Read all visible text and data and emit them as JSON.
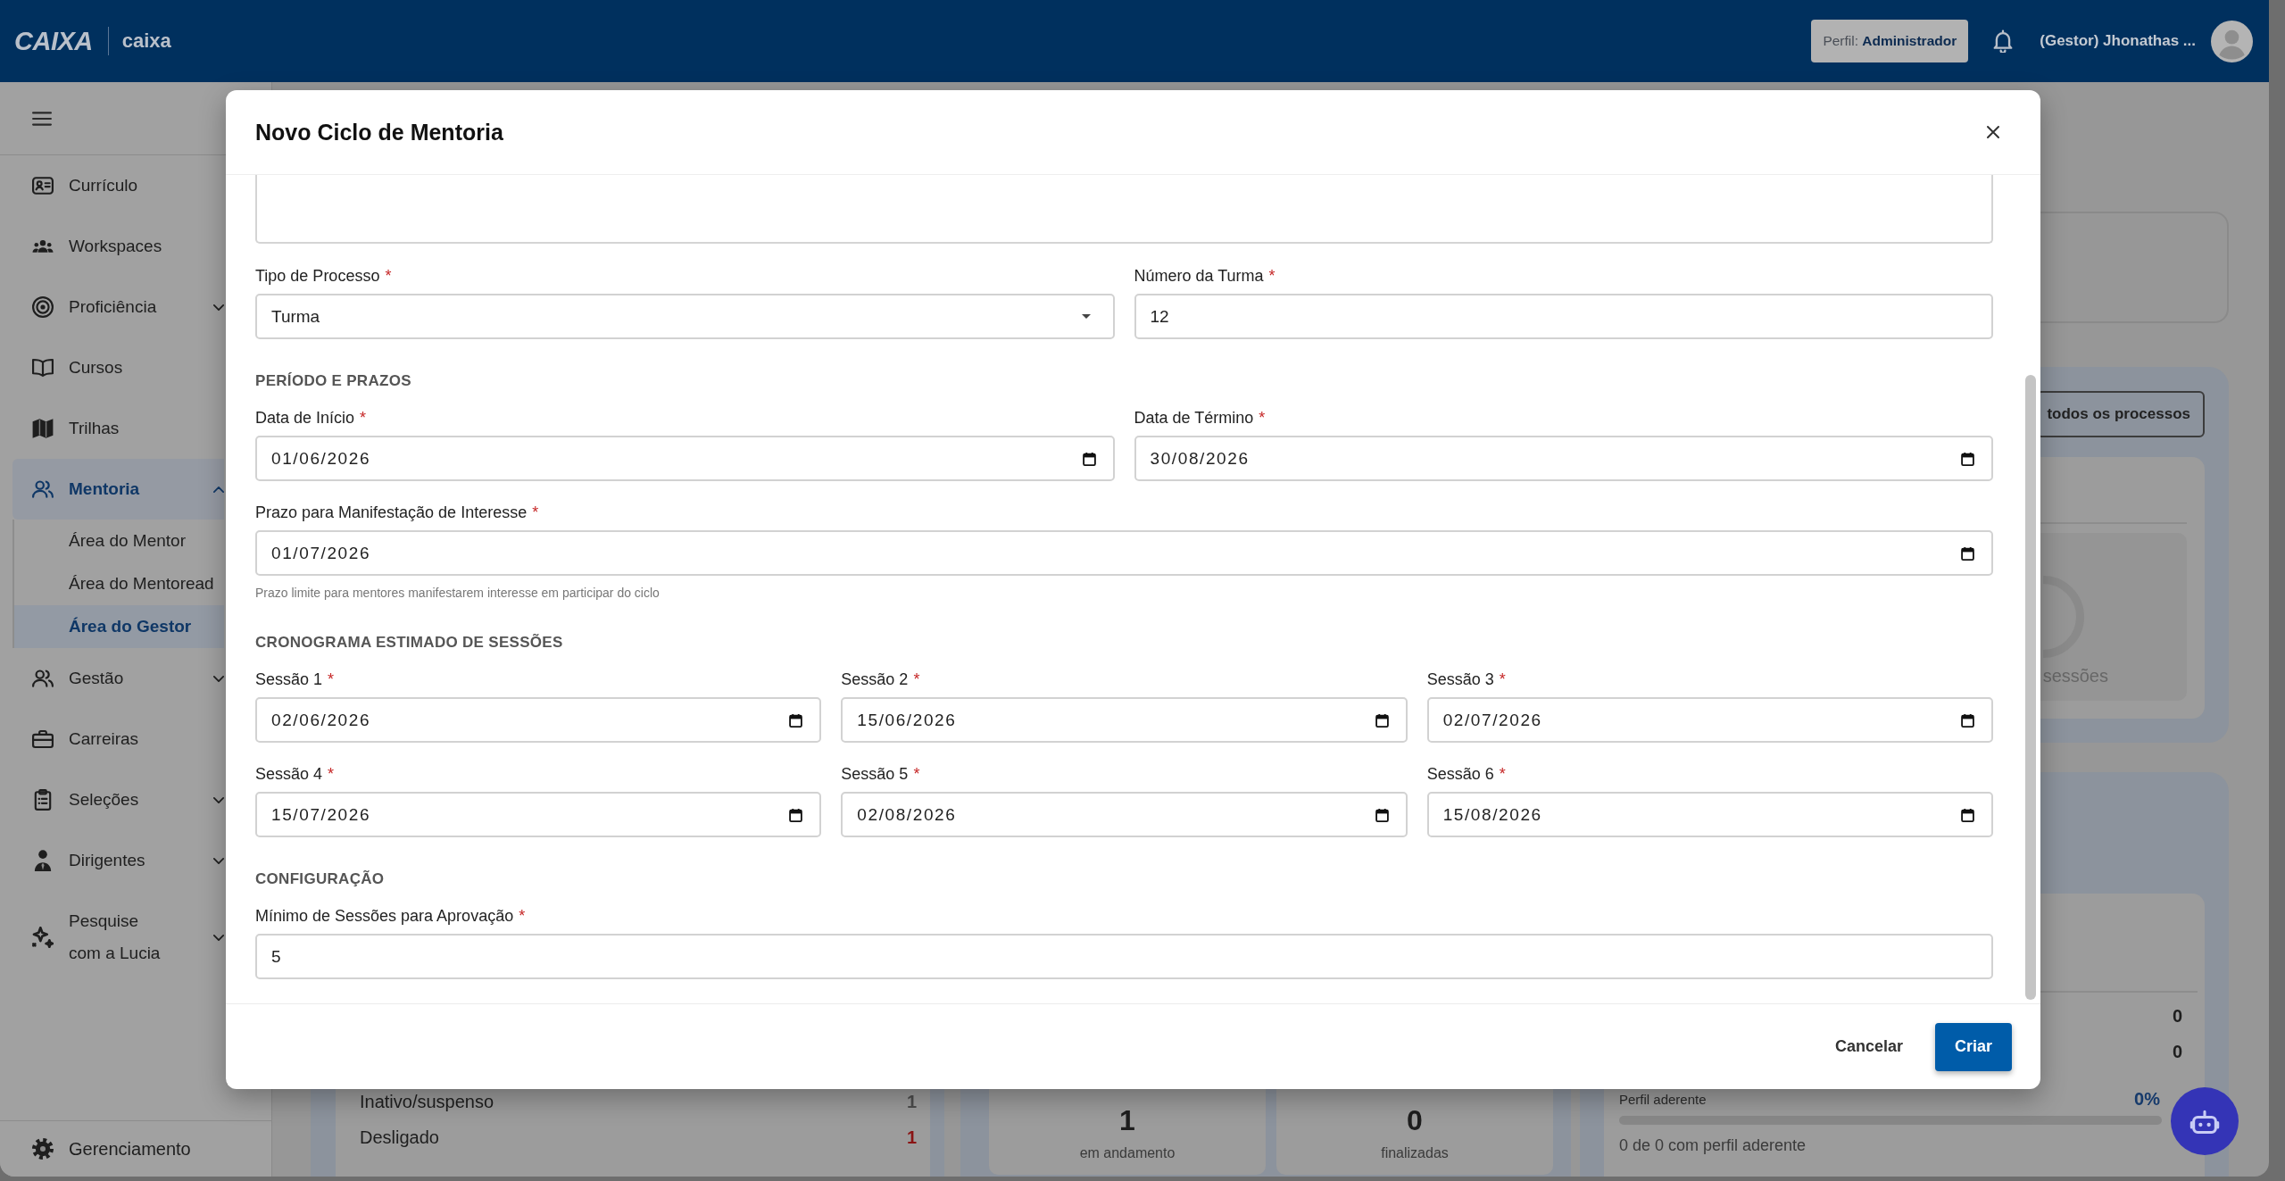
{
  "header": {
    "logo": "CAIXA",
    "app_name": "caixa",
    "profile": "Perfil: **Administrador**",
    "user_name": "(Gestor) Jhonathas ..."
  },
  "sidebar": {
    "items": [
      {
        "kind": "link",
        "label": "Currículo",
        "selected": false
      },
      {
        "kind": "link",
        "label": "Workspaces",
        "selected": false
      },
      {
        "kind": "group",
        "label": "Proficiência",
        "selected": false,
        "expanded": false
      },
      {
        "kind": "link",
        "label": "Cursos",
        "selected": false
      },
      {
        "kind": "link",
        "label": "Trilhas",
        "selected": false
      },
      {
        "kind": "group",
        "label": "Mentoria",
        "selected": true,
        "expanded": true,
        "children": [
          {
            "label": "Área do Mentor",
            "selected": false
          },
          {
            "label": "Área do Mentoread",
            "selected": false
          },
          {
            "label": "Área do Gestor",
            "selected": true
          }
        ]
      },
      {
        "kind": "group",
        "label": "Gestão",
        "selected": false,
        "expanded": false
      },
      {
        "kind": "link",
        "label": "Carreiras",
        "selected": false
      },
      {
        "kind": "group",
        "label": "Seleções",
        "selected": false,
        "expanded": false
      },
      {
        "kind": "group",
        "label": "Dirigentes",
        "selected": false,
        "expanded": false
      },
      {
        "kind": "group",
        "label": "Pesquise com a Lucia",
        "selected": false,
        "expanded": false
      }
    ],
    "footer_item": {
      "label": "Gerenciamento"
    }
  },
  "dashboard": {
    "all_processes_button": "todos os processos",
    "sessions_caption": "sessões",
    "counters": [
      "0",
      "0"
    ],
    "profile_match": {
      "label": "Perfil aderente",
      "percent": "0%",
      "level": 0,
      "summary": "0 de 0 com perfil aderente"
    },
    "status_rows": [
      {
        "label": "Inativo/suspenso",
        "count": "1",
        "color": "#4d4d4d"
      },
      {
        "label": "Desligado",
        "count": "1",
        "color": "#8a1414"
      }
    ],
    "cycle_cards": [
      {
        "value": "1",
        "label": "em andamento"
      },
      {
        "value": "0",
        "label": "finalizadas"
      }
    ]
  },
  "modal": {
    "title": "Novo Ciclo de Mentoria",
    "blocks": [
      {
        "kind": "textarea"
      },
      {
        "kind": "row",
        "fields": [
          {
            "kind": "select",
            "label": "Tipo de Processo",
            "mark": "*",
            "value": "Turma"
          },
          {
            "kind": "text",
            "label": "Número da Turma",
            "mark": "*",
            "value": "12"
          }
        ]
      },
      {
        "kind": "heading",
        "text": "PERÍODO E PRAZOS"
      },
      {
        "kind": "row",
        "fields": [
          {
            "kind": "date",
            "label": "Data de Início",
            "mark": "*",
            "value": "01/06/2026"
          },
          {
            "kind": "date",
            "label": "Data de Término",
            "mark": "*",
            "value": "30/08/2026"
          }
        ]
      },
      {
        "kind": "row",
        "fields": [
          {
            "kind": "date",
            "label": "Prazo para Manifestação de Interesse",
            "mark": "*",
            "value": "01/07/2026",
            "hint": "Prazo limite para mentores manifestarem interesse em participar do ciclo"
          }
        ]
      },
      {
        "kind": "heading",
        "text": "CRONOGRAMA ESTIMADO DE SESSÕES"
      },
      {
        "kind": "row",
        "fields": [
          {
            "kind": "date",
            "label": "Sessão 1",
            "mark": "*",
            "value": "02/06/2026"
          },
          {
            "kind": "date",
            "label": "Sessão 2",
            "mark": "*",
            "value": "15/06/2026"
          },
          {
            "kind": "date",
            "label": "Sessão 3",
            "mark": "*",
            "value": "02/07/2026"
          }
        ]
      },
      {
        "kind": "row",
        "fields": [
          {
            "kind": "date",
            "label": "Sessão 4",
            "mark": "*",
            "value": "15/07/2026"
          },
          {
            "kind": "date",
            "label": "Sessão 5",
            "mark": "*",
            "value": "02/08/2026"
          },
          {
            "kind": "date",
            "label": "Sessão 6",
            "mark": "*",
            "value": "15/08/2026"
          }
        ]
      },
      {
        "kind": "heading",
        "text": "CONFIGURAÇÃO"
      },
      {
        "kind": "row",
        "fields": [
          {
            "kind": "text",
            "label": "Mínimo de Sessões para Aprovação",
            "mark": "*",
            "value": "5"
          }
        ]
      }
    ],
    "buttons": [
      {
        "kind": "cancel",
        "label": "Cancelar"
      },
      {
        "kind": "submit",
        "label": "Criar"
      }
    ]
  }
}
